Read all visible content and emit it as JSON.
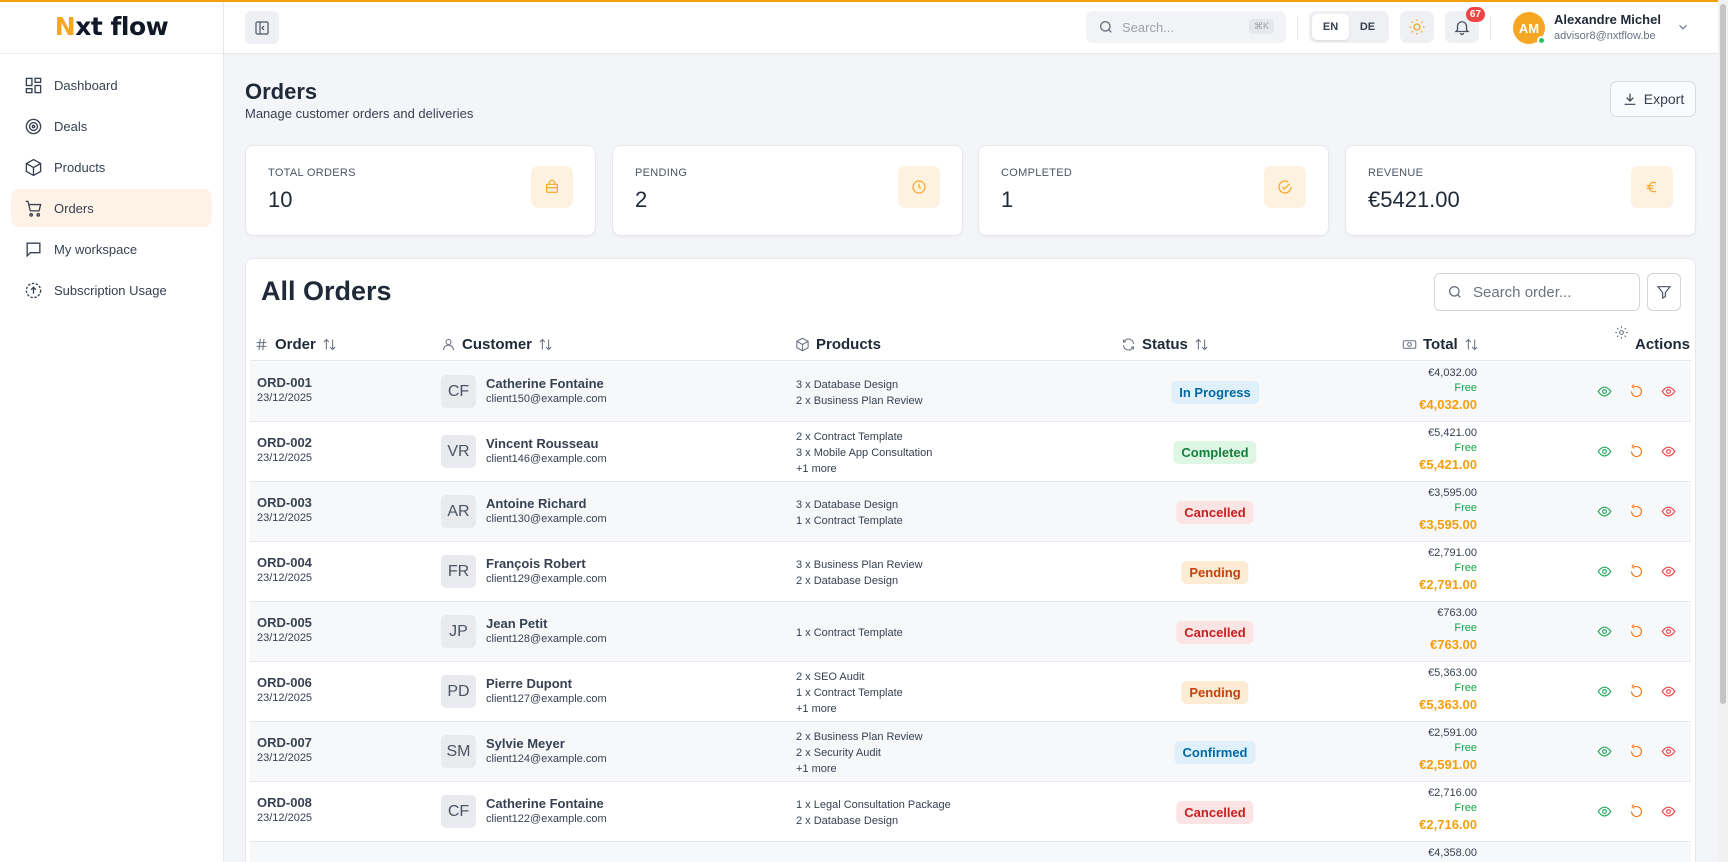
{
  "brand": {
    "logo_prefix": "N",
    "logo_rest": "xt flow",
    "accent": "#f5a623"
  },
  "sidebar": {
    "items": [
      {
        "label": "Dashboard",
        "icon": "dashboard-icon"
      },
      {
        "label": "Deals",
        "icon": "target-icon"
      },
      {
        "label": "Products",
        "icon": "box-icon"
      },
      {
        "label": "Orders",
        "icon": "cart-icon",
        "active": true
      },
      {
        "label": "My workspace",
        "icon": "chat-icon"
      },
      {
        "label": "Subscription Usage",
        "icon": "usage-icon"
      }
    ]
  },
  "header": {
    "search_placeholder": "Search...",
    "search_shortcut": "⌘K",
    "languages": [
      "EN",
      "DE"
    ],
    "notifications_count": "67",
    "user": {
      "initials": "AM",
      "name": "Alexandre Michel",
      "email": "advisor8@nxtflow.be"
    }
  },
  "page": {
    "title": "Orders",
    "subtitle": "Manage customer orders and deliveries",
    "export_label": "Export"
  },
  "stats": [
    {
      "label": "TOTAL ORDERS",
      "value": "10",
      "icon": "bag-icon"
    },
    {
      "label": "PENDING",
      "value": "2",
      "icon": "clock-icon"
    },
    {
      "label": "COMPLETED",
      "value": "1",
      "icon": "check-circle-icon"
    },
    {
      "label": "REVENUE",
      "value": "€5421.00",
      "icon": "euro-icon"
    }
  ],
  "orders_table": {
    "title": "All Orders",
    "search_placeholder": "Search order...",
    "columns": {
      "order": "Order",
      "customer": "Customer",
      "products": "Products",
      "status": "Status",
      "total": "Total",
      "actions": "Actions"
    },
    "rows": [
      {
        "id": "ORD-001",
        "date": "23/12/2025",
        "initials": "CF",
        "name": "Catherine Fontaine",
        "email": "client150@example.com",
        "products": [
          "3 x Database Design",
          "2 x Business Plan Review",
          ""
        ],
        "status": "In Progress",
        "status_key": "progress",
        "subtotal": "€4,032.00",
        "shipping": "Free",
        "total": "€4,032.00"
      },
      {
        "id": "ORD-002",
        "date": "23/12/2025",
        "initials": "VR",
        "name": "Vincent Rousseau",
        "email": "client146@example.com",
        "products": [
          "2 x Contract Template",
          "3 x Mobile App Consultation",
          "+1 more"
        ],
        "status": "Completed",
        "status_key": "completed",
        "subtotal": "€5,421.00",
        "shipping": "Free",
        "total": "€5,421.00"
      },
      {
        "id": "ORD-003",
        "date": "23/12/2025",
        "initials": "AR",
        "name": "Antoine Richard",
        "email": "client130@example.com",
        "products": [
          "3 x Database Design",
          "1 x Contract Template",
          ""
        ],
        "status": "Cancelled",
        "status_key": "cancelled",
        "subtotal": "€3,595.00",
        "shipping": "Free",
        "total": "€3,595.00"
      },
      {
        "id": "ORD-004",
        "date": "23/12/2025",
        "initials": "FR",
        "name": "François Robert",
        "email": "client129@example.com",
        "products": [
          "3 x Business Plan Review",
          "2 x Database Design",
          ""
        ],
        "status": "Pending",
        "status_key": "pending",
        "subtotal": "€2,791.00",
        "shipping": "Free",
        "total": "€2,791.00"
      },
      {
        "id": "ORD-005",
        "date": "23/12/2025",
        "initials": "JP",
        "name": "Jean Petit",
        "email": "client128@example.com",
        "products": [
          "1 x Contract Template",
          "",
          ""
        ],
        "status": "Cancelled",
        "status_key": "cancelled",
        "subtotal": "€763.00",
        "shipping": "Free",
        "total": "€763.00"
      },
      {
        "id": "ORD-006",
        "date": "23/12/2025",
        "initials": "PD",
        "name": "Pierre Dupont",
        "email": "client127@example.com",
        "products": [
          "2 x SEO Audit",
          "1 x Contract Template",
          "+1 more"
        ],
        "status": "Pending",
        "status_key": "pending",
        "subtotal": "€5,363.00",
        "shipping": "Free",
        "total": "€5,363.00"
      },
      {
        "id": "ORD-007",
        "date": "23/12/2025",
        "initials": "SM",
        "name": "Sylvie Meyer",
        "email": "client124@example.com",
        "products": [
          "2 x Business Plan Review",
          "2 x Security Audit",
          "+1 more"
        ],
        "status": "Confirmed",
        "status_key": "confirmed",
        "subtotal": "€2,591.00",
        "shipping": "Free",
        "total": "€2,591.00"
      },
      {
        "id": "ORD-008",
        "date": "23/12/2025",
        "initials": "CF",
        "name": "Catherine Fontaine",
        "email": "client122@example.com",
        "products": [
          "1 x Legal Consultation Package",
          "2 x Database Design",
          ""
        ],
        "status": "Cancelled",
        "status_key": "cancelled",
        "subtotal": "€2,716.00",
        "shipping": "Free",
        "total": "€2,716.00"
      },
      {
        "id": "",
        "date": "",
        "initials": "",
        "name": "",
        "email": "",
        "products": [
          "",
          "",
          ""
        ],
        "status": "",
        "status_key": "",
        "subtotal": "€4,358.00",
        "shipping": "",
        "total": ""
      }
    ]
  }
}
